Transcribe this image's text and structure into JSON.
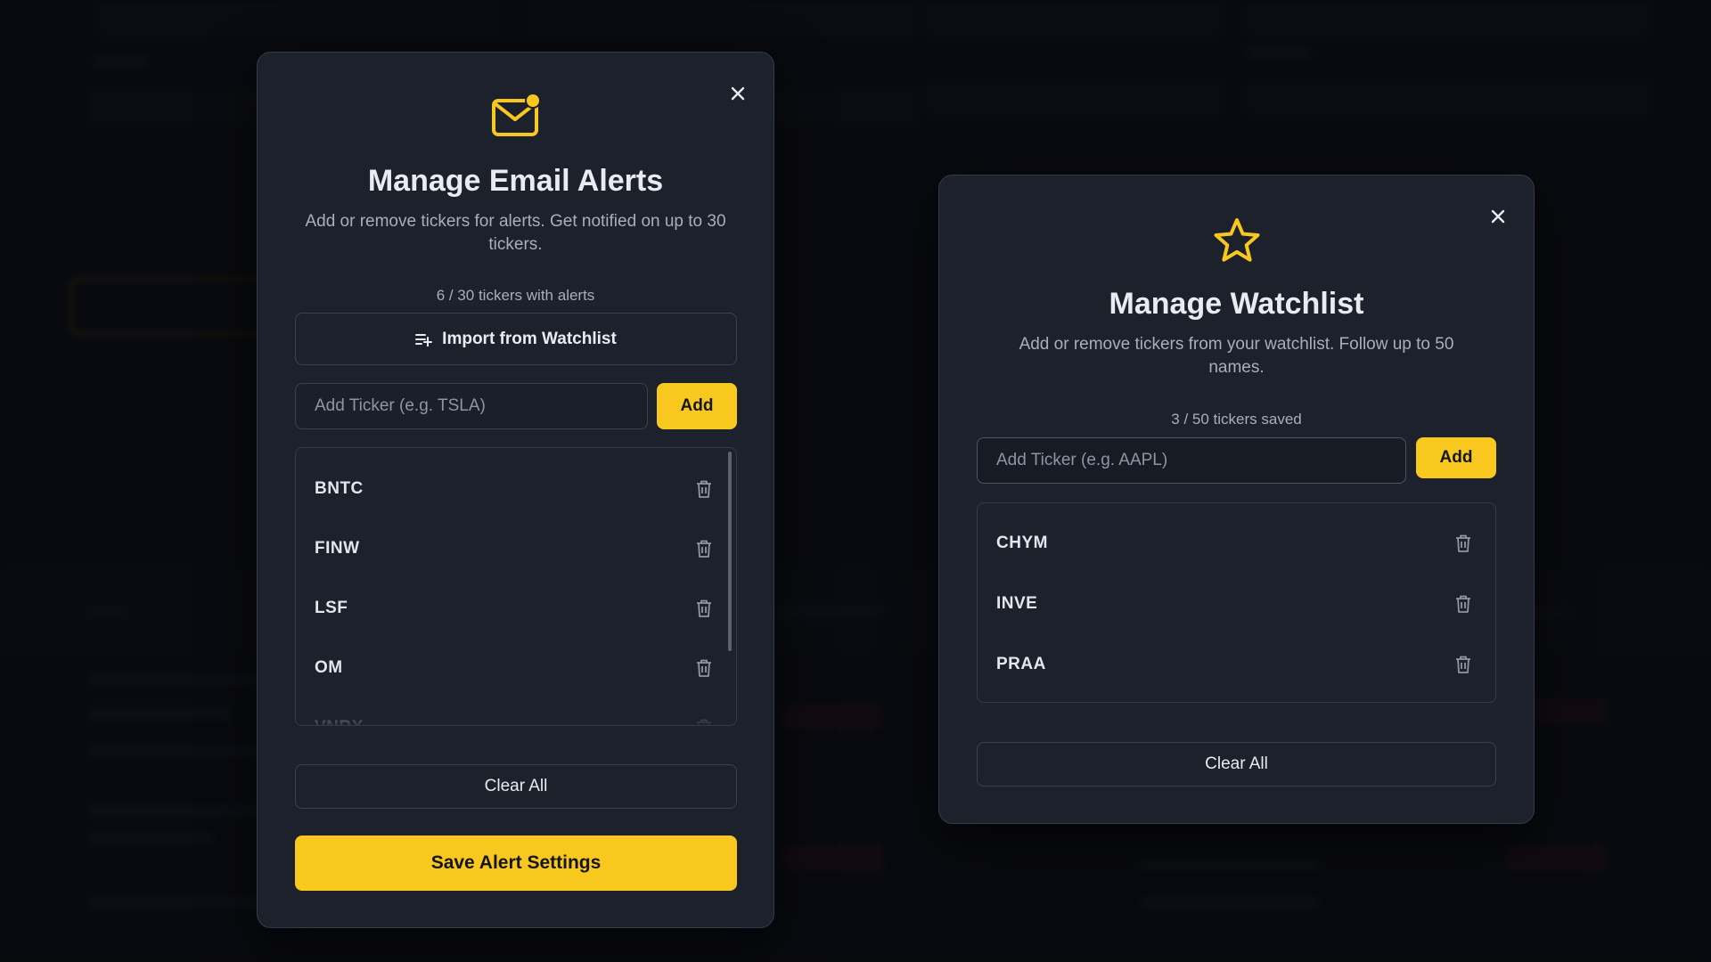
{
  "colors": {
    "accent": "#f8c81e",
    "modal_bg": "#1c212b",
    "border": "#343b48",
    "text_primary": "#e9ebf0",
    "text_muted": "#a8aebb"
  },
  "alerts_modal": {
    "icon": "mail-notification-icon",
    "title": "Manage Email Alerts",
    "description": "Add or remove tickers for alerts. Get notified on up to 30 tickers.",
    "count_text": "6 / 30 tickers with alerts",
    "import_button": {
      "icon": "playlist-add-icon",
      "label": "Import from Watchlist"
    },
    "ticker_input": {
      "placeholder": "Add Ticker (e.g. TSLA)",
      "value": ""
    },
    "add_label": "Add",
    "tickers": [
      "BNTC",
      "FINW",
      "LSF",
      "OM",
      "VNRX"
    ],
    "clear_label": "Clear All",
    "save_label": "Save Alert Settings"
  },
  "watchlist_modal": {
    "icon": "star-icon",
    "title": "Manage Watchlist",
    "description": "Add or remove tickers from your watchlist. Follow up to 50 names.",
    "count_text": "3 / 50 tickers saved",
    "ticker_input": {
      "placeholder": "Add Ticker (e.g. AAPL)",
      "value": ""
    },
    "add_label": "Add",
    "tickers": [
      "CHYM",
      "INVE",
      "PRAA"
    ],
    "clear_label": "Clear All"
  }
}
